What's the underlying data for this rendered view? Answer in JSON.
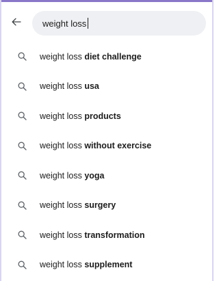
{
  "colors": {
    "accent": "#8a77c8",
    "search_bg": "#eff0f3",
    "text": "#1c1c1c",
    "icon": "#5f6368"
  },
  "header": {
    "back_icon": "arrow-left-icon",
    "search": {
      "value": "weight loss"
    }
  },
  "suggestions": [
    {
      "icon": "search-icon",
      "prefix": "weight loss ",
      "bold": "diet challenge"
    },
    {
      "icon": "search-icon",
      "prefix": "weight loss ",
      "bold": "usa"
    },
    {
      "icon": "search-icon",
      "prefix": "weight loss ",
      "bold": "products"
    },
    {
      "icon": "search-icon",
      "prefix": "weight loss ",
      "bold": "without exercise"
    },
    {
      "icon": "search-icon",
      "prefix": "weight loss ",
      "bold": "yoga"
    },
    {
      "icon": "search-icon",
      "prefix": "weight loss ",
      "bold": "surgery"
    },
    {
      "icon": "search-icon",
      "prefix": "weight loss ",
      "bold": "transformation"
    },
    {
      "icon": "search-icon",
      "prefix": "weight loss ",
      "bold": "supplement"
    }
  ]
}
